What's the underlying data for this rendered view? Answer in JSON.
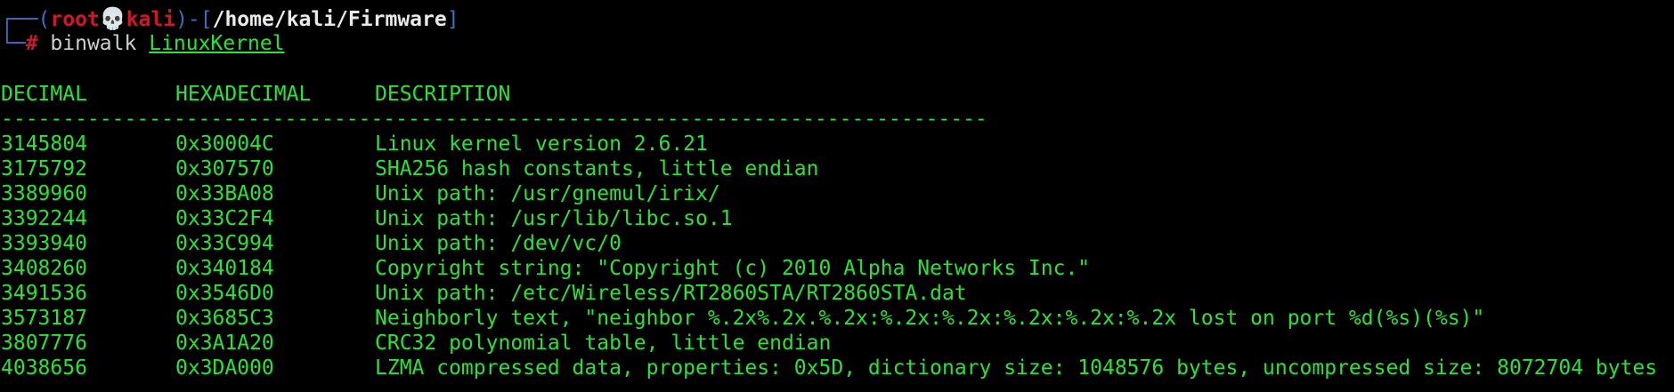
{
  "prompt": {
    "corner_top": "┌──(",
    "user": "root",
    "skull": "💀",
    "host": "kali",
    "bracket_mid": ")-[",
    "path": "/home/kali/Firmware",
    "bracket_end": "]",
    "corner_bottom": "└─",
    "hash": "#",
    "command": "binwalk",
    "argument": "LinuxKernel"
  },
  "table": {
    "headers": [
      "DECIMAL",
      "HEXADECIMAL",
      "DESCRIPTION"
    ],
    "separator": "--------------------------------------------------------------------------------",
    "rows": [
      [
        "3145804",
        "0x30004C",
        "Linux kernel version 2.6.21"
      ],
      [
        "3175792",
        "0x307570",
        "SHA256 hash constants, little endian"
      ],
      [
        "3389960",
        "0x33BA08",
        "Unix path: /usr/gnemul/irix/"
      ],
      [
        "3392244",
        "0x33C2F4",
        "Unix path: /usr/lib/libc.so.1"
      ],
      [
        "3393940",
        "0x33C994",
        "Unix path: /dev/vc/0"
      ],
      [
        "3408260",
        "0x340184",
        "Copyright string: \"Copyright (c) 2010 Alpha Networks Inc.\""
      ],
      [
        "3491536",
        "0x3546D0",
        "Unix path: /etc/Wireless/RT2860STA/RT2860STA.dat"
      ],
      [
        "3573187",
        "0x3685C3",
        "Neighborly text, \"neighbor %.2x%.2x.%.2x:%.2x:%.2x:%.2x:%.2x:%.2x lost on port %d(%s)(%s)\""
      ],
      [
        "3807776",
        "0x3A1A20",
        "CRC32 polynomial table, little endian"
      ],
      [
        "4038656",
        "0x3DA000",
        "LZMA compressed data, properties: 0x5D, dictionary size: 1048576 bytes, uncompressed size: 8072704 bytes"
      ]
    ]
  },
  "colors": {
    "background": "#000000",
    "output_green": "#27e533",
    "prompt_red": "#d1162a",
    "prompt_blue": "#3b6dc4"
  }
}
